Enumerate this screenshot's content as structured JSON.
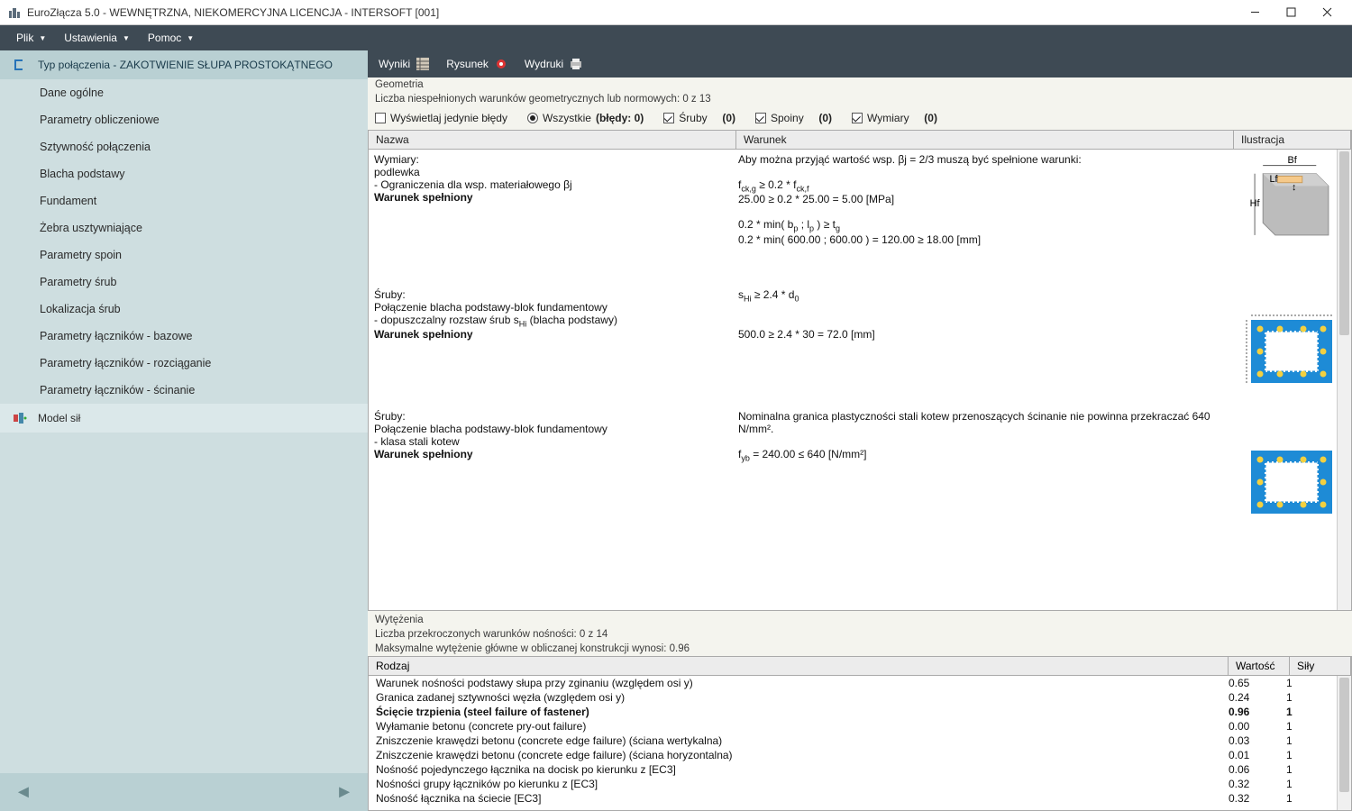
{
  "title": "EuroZłącza 5.0 - WEWNĘTRZNA, NIEKOMERCYJNA LICENCJA - INTERSOFT [001]",
  "menus": {
    "file": "Plik",
    "settings": "Ustawienia",
    "help": "Pomoc"
  },
  "sidebar": {
    "header": "Typ połączenia - ZAKOTWIENIE SŁUPA PROSTOKĄTNEGO",
    "items": [
      "Dane ogólne",
      "Parametry obliczeniowe",
      "Sztywność połączenia",
      "Blacha podstawy",
      "Fundament",
      "Żebra usztywniające",
      "Parametry spoin",
      "Parametry śrub",
      "Lokalizacja śrub",
      "Parametry łączników - bazowe",
      "Parametry łączników - rozciąganie",
      "Parametry łączników - ścinanie"
    ],
    "footer": "Model sił"
  },
  "toolbar": {
    "wyniki": "Wyniki",
    "rysunek": "Rysunek",
    "wydruki": "Wydruki"
  },
  "geom": {
    "title": "Geometria",
    "unmet": "Liczba niespełnionych warunków geometrycznych lub normowych: 0 z 13",
    "errOnly": "Wyświetlaj jedynie błędy",
    "all": "Wszystkie",
    "errCount": "(błędy: 0)",
    "sruby": "Śruby",
    "srubyC": "(0)",
    "spoiny": "Spoiny",
    "spoinyC": "(0)",
    "wymiary": "Wymiary",
    "wymiaryC": "(0)",
    "cols": {
      "nazwa": "Nazwa",
      "warunek": "Warunek",
      "ilu": "Ilustracja"
    }
  },
  "rows": [
    {
      "n1": "Wymiary:",
      "n2": "podlewka",
      "n3": "- Ograniczenia dla wsp. materiałowego βj",
      "n4": "Warunek spełniony",
      "w1": "Aby można przyjąć wartość wsp. βj = 2/3 muszą być spełnione warunki:",
      "w2": "fck,g ≥ 0.2 * fck,f",
      "w3": "25.00 ≥ 0.2 * 25.00 = 5.00 [MPa]",
      "w4": "0.2 * min( bp ; lp ) ≥ tg",
      "w5": "0.2 * min( 600.00 ; 600.00 ) = 120.00 ≥ 18.00 [mm]"
    },
    {
      "n1": "Śruby:",
      "n2": "Połączenie blacha podstawy-blok fundamentowy",
      "n3": "- dopuszczalny rozstaw śrub sHi (blacha podstawy)",
      "n4": "Warunek spełniony",
      "w1": "sHi ≥ 2.4 * d0",
      "w2": "500.0 ≥ 2.4 * 30 = 72.0 [mm]"
    },
    {
      "n1": "Śruby:",
      "n2": "Połączenie blacha podstawy-blok fundamentowy",
      "n3": "- klasa stali kotew",
      "n4": "Warunek spełniony",
      "w1": "Nominalna granica plastyczności stali kotew przenoszących ścinanie nie powinna przekraczać 640 N/mm².",
      "w2": "fyb = 240.00 ≤ 640 [N/mm²]"
    }
  ],
  "wyt": {
    "title": "Wytężenia",
    "l1": "Liczba przekroczonych warunków nośności: 0 z 14",
    "l2": "Maksymalne wytężenie główne w obliczanej konstrukcji wynosi: 0.96",
    "cols": {
      "rodzaj": "Rodzaj",
      "wart": "Wartość",
      "sily": "Siły"
    },
    "rows": [
      {
        "r": "Warunek nośności podstawy słupa przy zginaniu (względem osi y)",
        "w": "0.65",
        "s": "1"
      },
      {
        "r": "Granica zadanej sztywności węzła (względem osi y)",
        "w": "0.24",
        "s": "1"
      },
      {
        "r": "Ścięcie trzpienia (steel failure of fastener)",
        "w": "0.96",
        "s": "1",
        "b": true
      },
      {
        "r": "Wyłamanie betonu (concrete pry-out failure)",
        "w": "0.00",
        "s": "1"
      },
      {
        "r": "Zniszczenie krawędzi betonu (concrete edge failure) (ściana wertykalna)",
        "w": "0.03",
        "s": "1"
      },
      {
        "r": "Zniszczenie krawędzi betonu (concrete edge failure) (ściana horyzontalna)",
        "w": "0.01",
        "s": "1"
      },
      {
        "r": "Nośność pojedynczego łącznika na docisk po kierunku z [EC3]",
        "w": "0.06",
        "s": "1"
      },
      {
        "r": "Nośności grupy łączników po kierunku z [EC3]",
        "w": "0.32",
        "s": "1"
      },
      {
        "r": "Nośność łącznika na ściecie [EC3]",
        "w": "0.32",
        "s": "1"
      }
    ]
  }
}
